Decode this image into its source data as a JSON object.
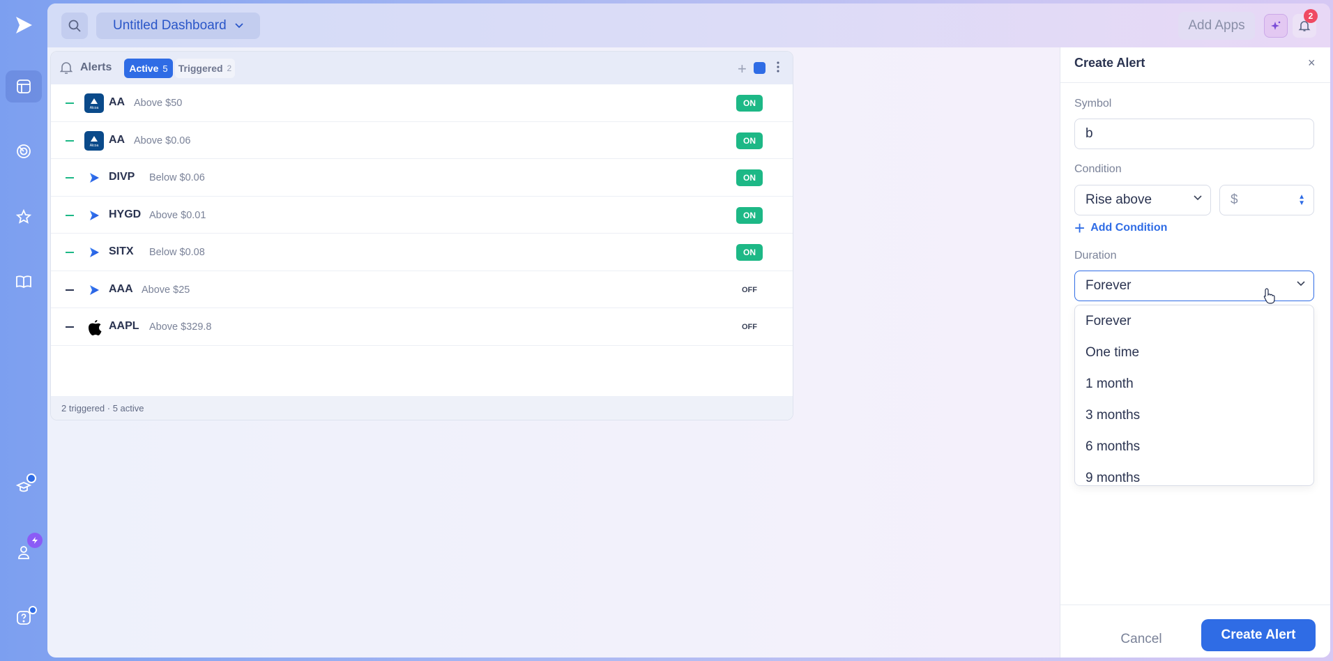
{
  "app": {
    "dashboard_title": "Untitled Dashboard",
    "add_apps_label": "Add Apps",
    "notification_count": "2"
  },
  "rail": {
    "icons": [
      "logo-icon",
      "dashboard-icon",
      "radar-icon",
      "star-icon",
      "book-icon",
      "education-icon",
      "user-icon",
      "help-icon"
    ]
  },
  "alerts": {
    "title": "Alerts",
    "tab_active": {
      "label": "Active",
      "count": "5"
    },
    "tab_triggered": {
      "label": "Triggered",
      "count": "2"
    },
    "footer": "2 triggered · 5 active",
    "rows": [
      {
        "symbol": "AA",
        "condition": "Above $50",
        "status": "ON",
        "logo": "alcoa-logo"
      },
      {
        "symbol": "AA",
        "condition": "Above $0.06",
        "status": "ON",
        "logo": "alcoa-logo"
      },
      {
        "symbol": "DIVP",
        "condition": "Below $0.06",
        "status": "ON",
        "logo": "play-logo"
      },
      {
        "symbol": "HYGD",
        "condition": "Above $0.01",
        "status": "ON",
        "logo": "play-logo"
      },
      {
        "symbol": "SITX",
        "condition": "Below $0.08",
        "status": "ON",
        "logo": "play-logo"
      },
      {
        "symbol": "AAA",
        "condition": "Above $25",
        "status": "OFF",
        "logo": "play-logo"
      },
      {
        "symbol": "AAPL",
        "condition": "Above $329.8",
        "status": "OFF",
        "logo": "apple-logo"
      }
    ],
    "colors": {
      "on": "#1db886",
      "accent": "#2f6ce5"
    }
  },
  "create_alert": {
    "title": "Create Alert",
    "close": "×",
    "symbol_label": "Symbol",
    "symbol_value": "b",
    "condition_label": "Condition",
    "condition_value": "Rise above",
    "price_value": "$",
    "add_condition": "Add Condition",
    "duration_label": "Duration",
    "duration_value": "Forever",
    "duration_options": [
      "Forever",
      "One time",
      "1 month",
      "3 months",
      "6 months",
      "9 months"
    ],
    "cancel": "Cancel",
    "submit": "Create Alert"
  }
}
